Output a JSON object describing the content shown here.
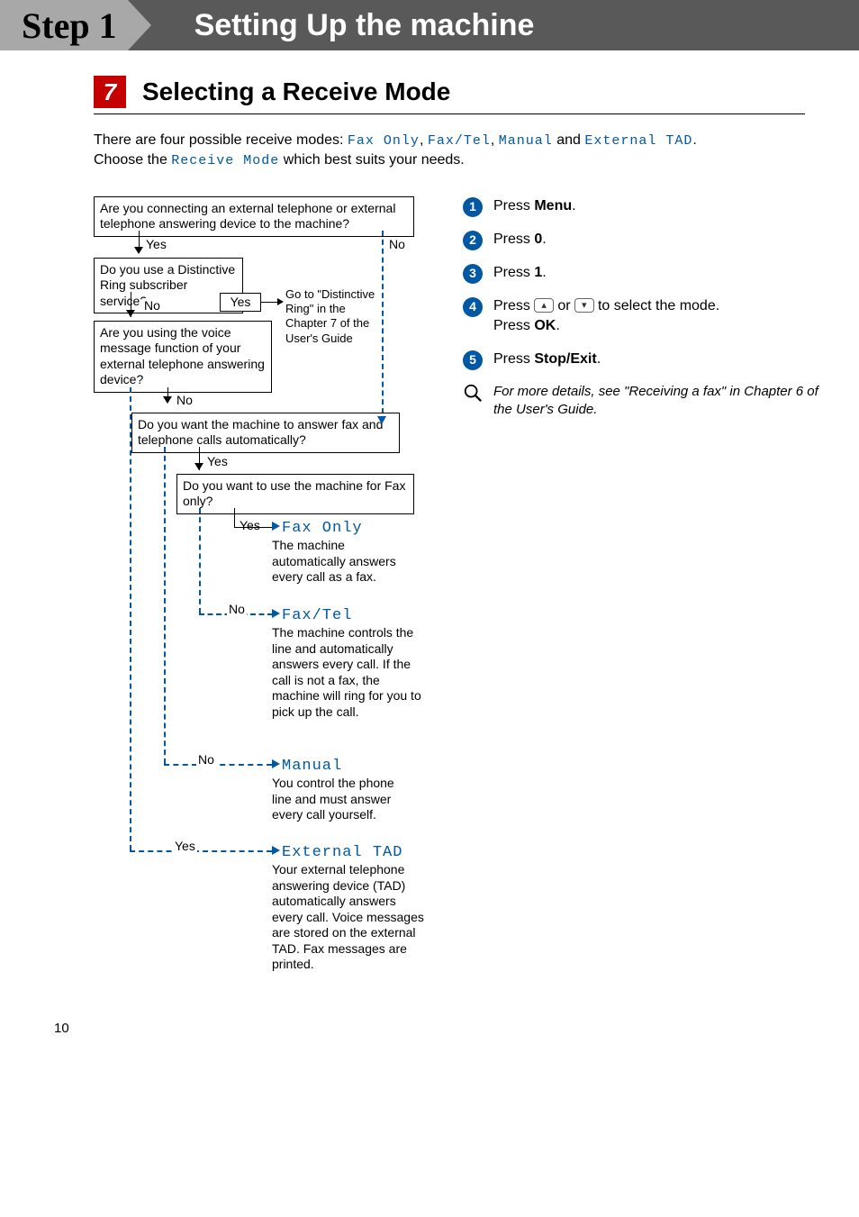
{
  "header": {
    "step_label": "Step 1",
    "title": "Setting Up the machine"
  },
  "section": {
    "number": "7",
    "title": "Selecting a Receive Mode"
  },
  "intro": {
    "line1_a": "There are four possible receive modes: ",
    "mode1": "Fax Only",
    "sep1": ", ",
    "mode2": "Fax/Tel",
    "sep2": ", ",
    "mode3": "Manual",
    "sep3": " and ",
    "mode4": "External TAD",
    "line1_end": ".",
    "line2_a": "Choose the ",
    "receive_mode": "Receive Mode",
    "line2_b": " which best suits your needs."
  },
  "flow": {
    "q1": "Are you connecting an external telephone or external telephone answering device to the machine?",
    "q1_yes": "Yes",
    "q1_no": "No",
    "q2": "Do you use a Distinctive Ring subscriber service?",
    "q2_no": "No",
    "q2_yes": "Yes",
    "goto": "Go to \"Distinctive Ring\" in the Chapter 7 of the User's Guide",
    "q3": "Are you using the voice message function of your external telephone answering device?",
    "q3_no": "No",
    "q4": "Do you want the machine to answer fax and telephone calls automatically?",
    "q4_yes": "Yes",
    "q4_no": "No",
    "q5": "Do you want to use the machine for Fax only?",
    "q5_yes": "Yes",
    "q5_no": "No",
    "yes_label_tad": "Yes",
    "out_faxonly_title": "Fax Only",
    "out_faxonly_desc": "The machine automatically answers every call as a fax.",
    "out_faxtel_title": "Fax/Tel",
    "out_faxtel_desc": "The machine controls the line and automatically answers every call. If the call is not a fax, the machine will ring for you to pick up the call.",
    "out_manual_title": "Manual",
    "out_manual_desc": "You control the phone line and must answer every call yourself.",
    "out_tad_title": "External TAD",
    "out_tad_desc": "Your external telephone answering device (TAD) automatically answers every call. Voice messages are stored on the external TAD. Fax messages are printed."
  },
  "steps": {
    "s1_a": "Press ",
    "s1_b": "Menu",
    "s1_c": ".",
    "s2_a": "Press ",
    "s2_b": "0",
    "s2_c": ".",
    "s3_a": "Press ",
    "s3_b": "1",
    "s3_c": ".",
    "s4_a": "Press ",
    "s4_mid": " or ",
    "s4_b": " to select the mode.",
    "s4_c": "Press ",
    "s4_d": "OK",
    "s4_e": ".",
    "s5_a": "Press ",
    "s5_b": "Stop/Exit",
    "s5_c": "."
  },
  "note": "For more details, see \"Receiving a fax\" in Chapter 6 of the User's Guide.",
  "page_number": "10"
}
